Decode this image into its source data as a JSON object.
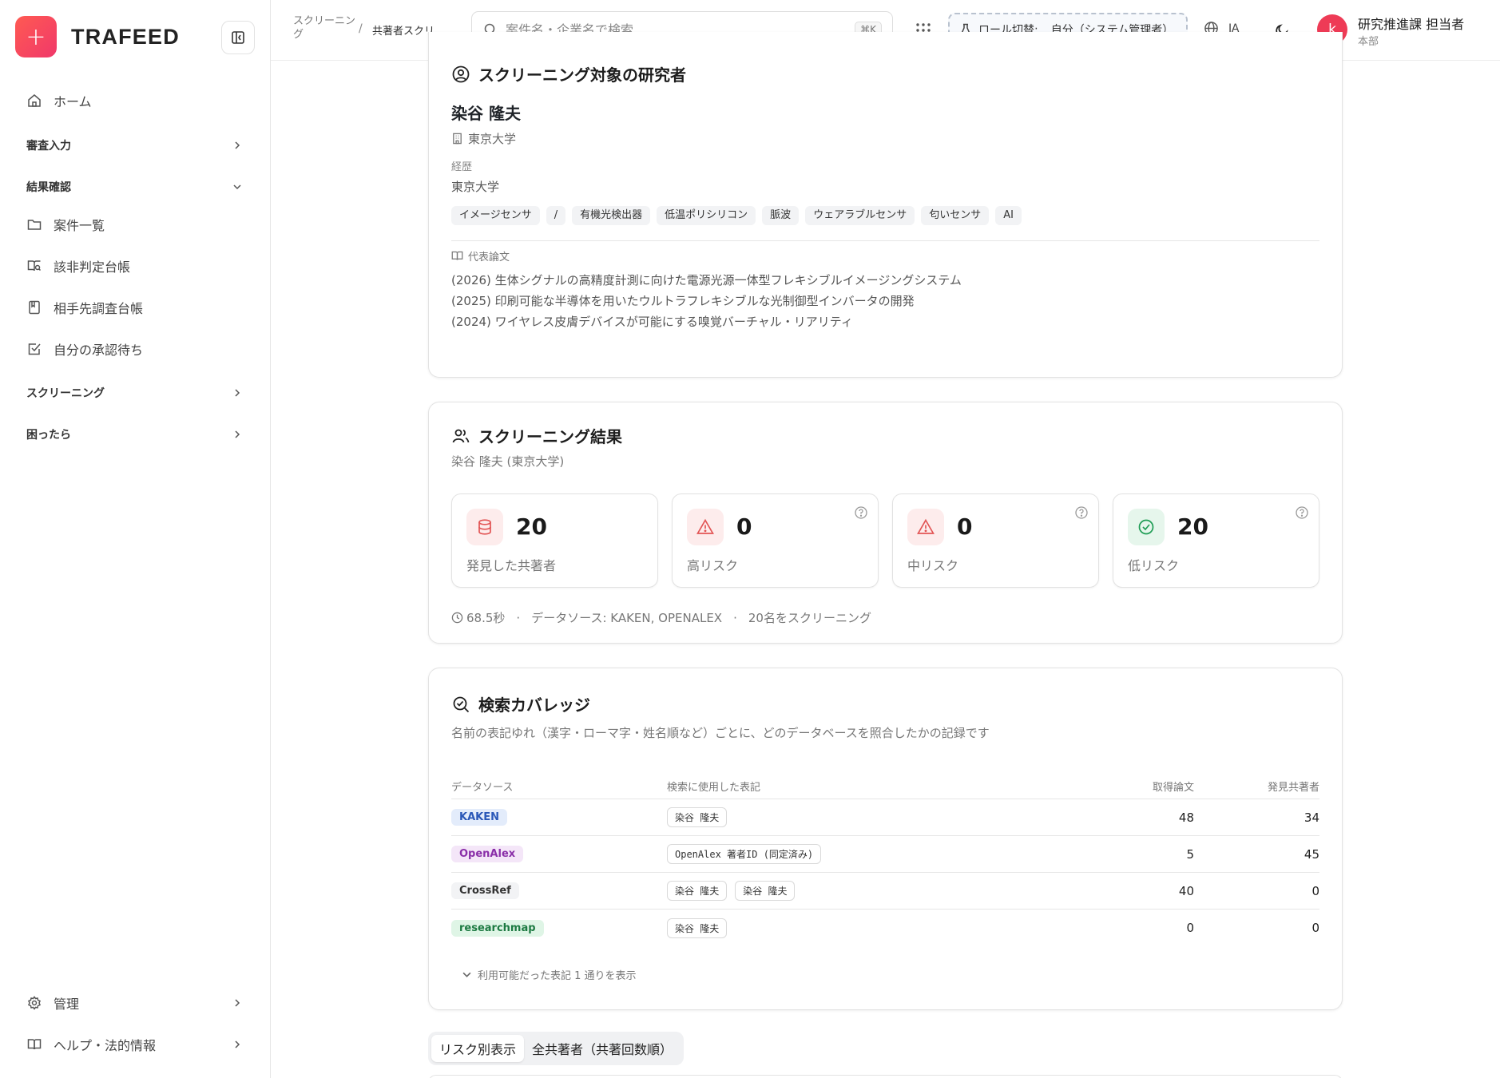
{
  "brand": {
    "name": "TRAFEED",
    "logo_glyph": "+"
  },
  "sidebar": {
    "home": "ホーム",
    "sections": {
      "review_input": "審査入力",
      "results": "結果確認",
      "screening": "スクリーニング",
      "help_trouble": "困ったら"
    },
    "results_items": [
      "案件一覧",
      "該非判定台帳",
      "相手先調査台帳",
      "自分の承認待ち"
    ],
    "footer": {
      "admin": "管理",
      "help_legal": "ヘルプ・法的情報"
    }
  },
  "topbar": {
    "breadcrumb": {
      "parent": "スクリーニング",
      "sep": "/",
      "current": "共著者スクリ..."
    },
    "search": {
      "placeholder": "案件名・企業名で検索",
      "shortcut": "⌘K"
    },
    "role": {
      "label": "ロール切替:",
      "value": "自分（システム管理者）"
    },
    "language": "JA",
    "user": {
      "avatar_letter": "k",
      "name": "研究推進課 担当者",
      "dept": "本部"
    }
  },
  "researcher_card": {
    "title": "スクリーニング対象の研究者",
    "name": "染谷 隆夫",
    "affiliation": "東京大学",
    "history_label": "経歴",
    "history_value": "東京大学",
    "tags": [
      "イメージセンサ",
      "/",
      "有機光検出器",
      "低温ポリシリコン",
      "脈波",
      "ウェアラブルセンサ",
      "匂いセンサ",
      "AI"
    ],
    "papers_label": "代表論文",
    "papers": [
      "(2026) 生体シグナルの高精度計測に向けた電源光源一体型フレキシブルイメージングシステム",
      "(2025) 印刷可能な半導体を用いたウルトラフレキシブルな光制御型インバータの開発",
      "(2024) ワイヤレス皮膚デバイスが可能にする嗅覚バーチャル・リアリティ"
    ]
  },
  "results_card": {
    "title": "スクリーニング結果",
    "subtitle": "染谷 隆夫 (東京大学)",
    "stats": [
      {
        "value": "20",
        "label": "発見した共著者",
        "icon": "database-icon",
        "color": "#e25555",
        "bg": "#fdecec"
      },
      {
        "value": "0",
        "label": "高リスク",
        "icon": "warning-icon",
        "color": "#e25555",
        "bg": "#fdecec"
      },
      {
        "value": "0",
        "label": "中リスク",
        "icon": "warning-icon",
        "color": "#e25555",
        "bg": "#fdecec"
      },
      {
        "value": "20",
        "label": "低リスク",
        "icon": "check-circle-icon",
        "color": "#1f9d55",
        "bg": "#e6f6ec"
      }
    ],
    "meta": {
      "duration": "68.5秒",
      "sources": "データソース: KAKEN, OPENALEX",
      "screened": "20名をスクリーニング"
    }
  },
  "coverage_card": {
    "title": "検索カバレッジ",
    "subtitle": "名前の表記ゆれ（漢字・ローマ字・姓名順など）ごとに、どのデータベースを照合したかの記録です",
    "columns": [
      "データソース",
      "検索に使用した表記",
      "取得論文",
      "発見共著者"
    ],
    "rows": [
      {
        "source": "KAKEN",
        "badge_bg": "#e3ecfb",
        "badge_fg": "#2b58b8",
        "chips": [
          "染谷 隆夫"
        ],
        "papers": "48",
        "coauthors": "34"
      },
      {
        "source": "OpenAlex",
        "badge_bg": "#f4e6f8",
        "badge_fg": "#8a2fa8",
        "chips": [
          "OpenAlex 著者ID (同定済み)"
        ],
        "papers": "5",
        "coauthors": "45"
      },
      {
        "source": "CrossRef",
        "badge_bg": "#f2f3f5",
        "badge_fg": "#333333",
        "chips": [
          "染谷 隆夫",
          "染谷 隆夫"
        ],
        "papers": "40",
        "coauthors": "0"
      },
      {
        "source": "researchmap",
        "badge_bg": "#dff5e6",
        "badge_fg": "#1d7a42",
        "chips": [
          "染谷 隆夫"
        ],
        "papers": "0",
        "coauthors": "0"
      }
    ],
    "show_more": "利用可能だった表記 1 通りを表示"
  },
  "tabs": [
    "リスク別表示",
    "全共著者（共著回数順）"
  ]
}
